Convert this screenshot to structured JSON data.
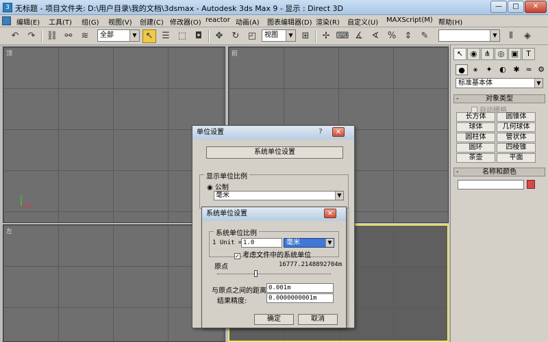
{
  "window": {
    "title": "无标题    - 项目文件夹: D:\\用户目录\\我的文档\\3dsmax    - Autodesk 3ds Max 9    - 显示 : Direct 3D",
    "min_glyph": "—",
    "max_glyph": "□",
    "close_glyph": "✕"
  },
  "menu": [
    "编辑(E)",
    "工具(T)",
    "组(G)",
    "视图(V)",
    "创建(C)",
    "修改器(O)",
    "reactor",
    "动画(A)",
    "图表编辑器(D)",
    "渲染(R)",
    "自定义(U)",
    "MAXScript(M)",
    "帮助(H)"
  ],
  "toolbar": {
    "selection_filter": "全部",
    "reference_coord": "视图",
    "named_selection": "",
    "undo_icon": "undo-icon",
    "redo_icon": "redo-icon"
  },
  "viewports": {
    "top": "顶",
    "front": "前",
    "left": "左"
  },
  "command_panel": {
    "category_dropdown": "标准基本体",
    "object_type_header": "对象类型",
    "autogrid_label": "自动栅格",
    "object_buttons": [
      "长方体",
      "圆锥体",
      "球体",
      "几何球体",
      "圆柱体",
      "管状体",
      "圆环",
      "四棱锥",
      "茶壶",
      "平面"
    ],
    "name_color_header": "名称和颜色",
    "object_color": "#d84a4a"
  },
  "units_dialog": {
    "title": "单位设置",
    "help_glyph": "?",
    "close_glyph": "✕",
    "system_units_button": "系统单位设置",
    "display_scale_group": "显示单位比例",
    "metric_label": "公制",
    "metric_unit": "毫米"
  },
  "system_units_dialog": {
    "title": "系统单位设置",
    "close_glyph": "✕",
    "scale_group": "系统单位比例",
    "unit_prefix": "1 Unit =",
    "unit_value": "1.0",
    "unit_type": "毫米",
    "consider_files_label": "考虑文件中的系统单位",
    "origin_label": "原点",
    "origin_value": "16777.2148892704m",
    "distance_label": "与原点之间的距离:",
    "distance_value": "0.001m",
    "precision_label": "结果精度:",
    "precision_value": "0.0000000001m",
    "ok_button": "确定",
    "cancel_button": "取消"
  }
}
